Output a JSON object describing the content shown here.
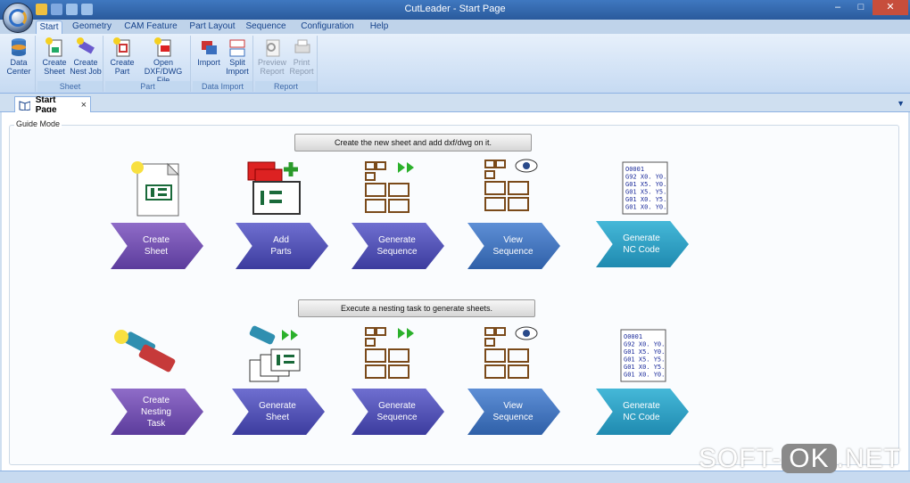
{
  "window": {
    "title": "CutLeader - Start Page"
  },
  "ribbon": {
    "tabs": [
      "Start",
      "Geometry",
      "CAM Feature",
      "Part Layout",
      "Sequence",
      "Configuration",
      "Help"
    ],
    "groups": {
      "data_center": {
        "label_l1": "Data",
        "label_l2": "Center"
      },
      "sheet": {
        "title": "Sheet",
        "create_sheet_l1": "Create",
        "create_sheet_l2": "Sheet",
        "create_nest_l1": "Create",
        "create_nest_l2": "Nest Job"
      },
      "part": {
        "title": "Part",
        "create_part_l1": "Create",
        "create_part_l2": "Part",
        "open_dxf_l1": "Open",
        "open_dxf_l2": "DXF/DWG File"
      },
      "data_import": {
        "title": "Data Import",
        "import": "Import",
        "split_l1": "Split",
        "split_l2": "Import"
      },
      "report": {
        "title": "Report",
        "preview_l1": "Preview",
        "preview_l2": "Report",
        "print_l1": "Print",
        "print_l2": "Report"
      }
    }
  },
  "doc_tab": {
    "label": "Start Page",
    "close": "×"
  },
  "guide": {
    "label": "Guide Mode",
    "row1_button": "Create the new sheet and add dxf/dwg on it.",
    "row2_button": "Execute a nesting task to generate sheets.",
    "row1": [
      "Create\nSheet",
      "Add\nParts",
      "Generate\nSequence",
      "View\nSequence",
      "Generate\nNC Code"
    ],
    "row2": [
      "Create\nNesting\nTask",
      "Generate\nSheet",
      "Generate\nSequence",
      "View\nSequence",
      "Generate\nNC Code"
    ],
    "nc_lines": [
      "O0001",
      "G92 X0. Y0.",
      "G01 X5. Y0.",
      "G01 X5. Y5.",
      "G01 X0. Y5.",
      "G01 X0. Y0."
    ]
  },
  "watermark": {
    "left": "SOFT-",
    "ok": "OK",
    "right": ".NET"
  },
  "colors": {
    "purple": "#6e4fb0",
    "indigo": "#4a4ab2",
    "blue": "#3a6fbe",
    "teal": "#2aa0c4"
  }
}
